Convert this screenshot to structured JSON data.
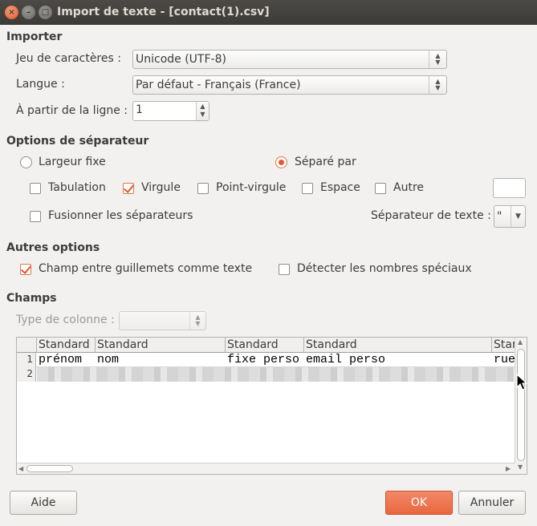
{
  "window": {
    "title": "Import de texte - [contact(1).csv]",
    "close_glyph": "×",
    "min_glyph": "–",
    "max_glyph": "□"
  },
  "importer": {
    "heading": "Importer",
    "charset_label": "Jeu de caractères :",
    "charset_value": "Unicode (UTF-8)",
    "language_label": "Langue :",
    "language_value": "Par défaut - Français (France)",
    "from_line_label": "À partir de la ligne :",
    "from_line_value": "1"
  },
  "separator": {
    "heading": "Options de séparateur",
    "fixed_width": {
      "label": "Largeur fixe",
      "selected": false
    },
    "separated_by": {
      "label": "Séparé par",
      "selected": true
    },
    "tab": {
      "label": "Tabulation",
      "checked": false
    },
    "comma": {
      "label": "Virgule",
      "checked": true
    },
    "semicolon": {
      "label": "Point-virgule",
      "checked": false
    },
    "space": {
      "label": "Espace",
      "checked": false
    },
    "other": {
      "label": "Autre",
      "checked": false
    },
    "merge": {
      "label": "Fusionner les séparateurs",
      "checked": false
    },
    "text_delimiter_label": "Séparateur de texte :",
    "text_delimiter_value": "\""
  },
  "other_options": {
    "heading": "Autres options",
    "quoted_as_text": {
      "label": "Champ entre guillemets comme texte",
      "checked": true
    },
    "detect_special": {
      "label": "Détecter les nombres spéciaux",
      "checked": false
    }
  },
  "fields": {
    "heading": "Champs",
    "column_type_label": "Type de colonne :",
    "headers": [
      "Standard",
      "Standard",
      "Standard",
      "Standard",
      "Stan"
    ],
    "rows": [
      {
        "num": "1",
        "cells": [
          "prénom",
          "nom",
          "fixe perso",
          "email perso",
          "rue"
        ]
      },
      {
        "num": "2",
        "cells": []
      }
    ]
  },
  "buttons": {
    "help": "Aide",
    "ok": "OK",
    "cancel": "Annuler"
  },
  "colors": {
    "accent": "#e05a2a",
    "titlebar": "#3c3b37",
    "dialog_bg": "#f2f1f0"
  }
}
